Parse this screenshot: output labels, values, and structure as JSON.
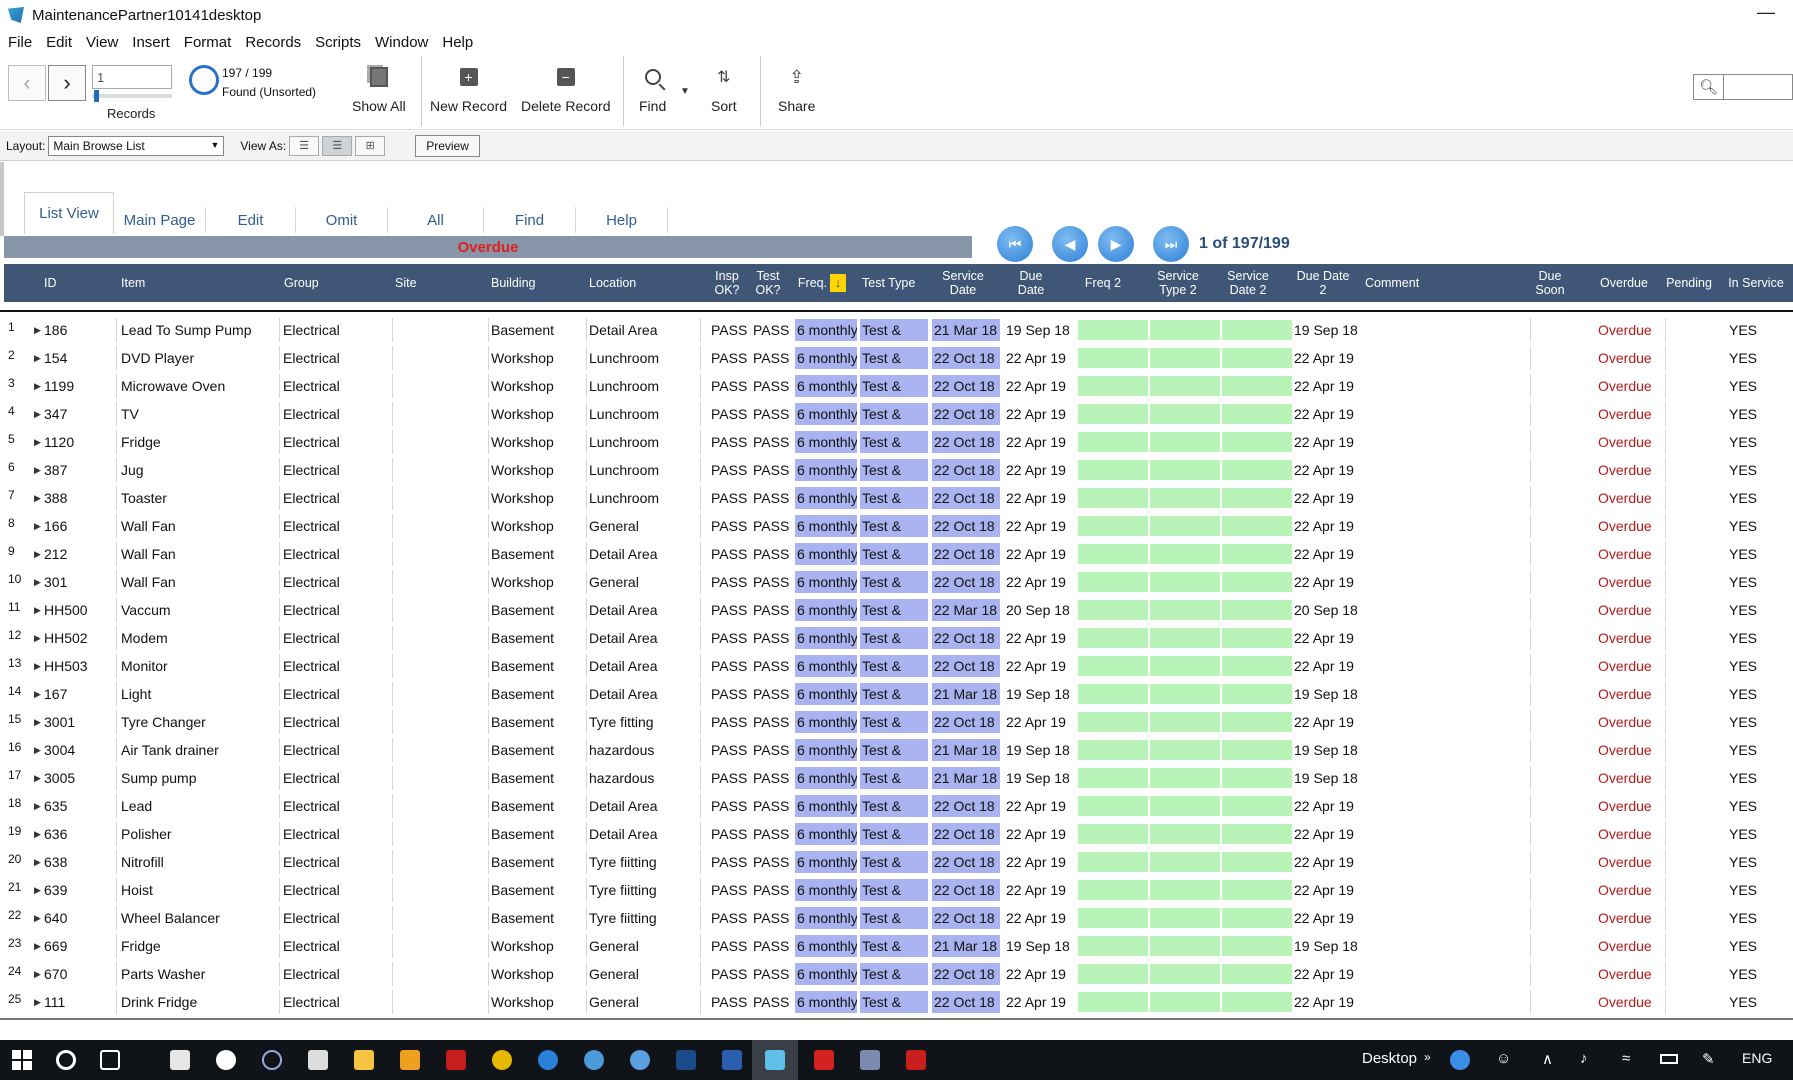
{
  "window": {
    "title": "MaintenancePartner10141desktop",
    "minimize_glyph": "—"
  },
  "menu": [
    "File",
    "Edit",
    "View",
    "Insert",
    "Format",
    "Records",
    "Scripts",
    "Window",
    "Help"
  ],
  "toolbar": {
    "record_input_value": "1",
    "records_label": "Records",
    "found_count": "197 / 199",
    "found_state": "Found (Unsorted)",
    "show_all": "Show All",
    "new_record": "New Record",
    "delete_record": "Delete Record",
    "find": "Find",
    "sort": "Sort",
    "share": "Share"
  },
  "layoutbar": {
    "layout_label": "Layout:",
    "layout_value": "Main Browse List",
    "view_as_label": "View As:",
    "preview": "Preview"
  },
  "tabs": [
    "List View",
    "Main Page",
    "Edit",
    "Omit",
    "All",
    "Find",
    "Help"
  ],
  "status": {
    "overdue_banner": "Overdue",
    "record_position": "1 of 197/199"
  },
  "columns": {
    "id": "ID",
    "item": "Item",
    "group": "Group",
    "site": "Site",
    "building": "Building",
    "location": "Location",
    "insp_ok": "Insp OK?",
    "test_ok": "Test OK?",
    "freq": "Freq.",
    "test_type": "Test Type",
    "service_date": "Service Date",
    "due_date": "Due Date",
    "freq2": "Freq 2",
    "service_type2": "Service Type 2",
    "service_date2": "Service Date 2",
    "due_date2": "Due Date  2",
    "comment": "Comment",
    "due_soon": "Due Soon",
    "overdue": "Overdue",
    "pending": "Pending",
    "in_service": "In Service"
  },
  "rows": [
    {
      "n": "1",
      "id": "186",
      "item": "Lead To Sump Pump",
      "group": "Electrical",
      "building": "Basement",
      "location": "Detail Area",
      "insp": "PASS",
      "test": "PASS",
      "freq": "6 monthly",
      "type": "Test &",
      "sdate": "21 Mar 18",
      "due": "19 Sep 18",
      "due2": "19 Sep 18",
      "overdue": "Overdue",
      "insvc": "YES"
    },
    {
      "n": "2",
      "id": "154",
      "item": "DVD Player",
      "group": "Electrical",
      "building": "Workshop",
      "location": "Lunchroom",
      "insp": "PASS",
      "test": "PASS",
      "freq": "6 monthly",
      "type": "Test &",
      "sdate": "22 Oct 18",
      "due": "22 Apr 19",
      "due2": "22 Apr 19",
      "overdue": "Overdue",
      "insvc": "YES"
    },
    {
      "n": "3",
      "id": "1199",
      "item": "Microwave Oven",
      "group": "Electrical",
      "building": "Workshop",
      "location": "Lunchroom",
      "insp": "PASS",
      "test": "PASS",
      "freq": "6 monthly",
      "type": "Test &",
      "sdate": "22 Oct 18",
      "due": "22 Apr 19",
      "due2": "22 Apr 19",
      "overdue": "Overdue",
      "insvc": "YES"
    },
    {
      "n": "4",
      "id": "347",
      "item": "TV",
      "group": "Electrical",
      "building": "Workshop",
      "location": "Lunchroom",
      "insp": "PASS",
      "test": "PASS",
      "freq": "6 monthly",
      "type": "Test &",
      "sdate": "22 Oct 18",
      "due": "22 Apr 19",
      "due2": "22 Apr 19",
      "overdue": "Overdue",
      "insvc": "YES"
    },
    {
      "n": "5",
      "id": "1120",
      "item": "Fridge",
      "group": "Electrical",
      "building": "Workshop",
      "location": "Lunchroom",
      "insp": "PASS",
      "test": "PASS",
      "freq": "6 monthly",
      "type": "Test &",
      "sdate": "22 Oct 18",
      "due": "22 Apr 19",
      "due2": "22 Apr 19",
      "overdue": "Overdue",
      "insvc": "YES"
    },
    {
      "n": "6",
      "id": "387",
      "item": "Jug",
      "group": "Electrical",
      "building": "Workshop",
      "location": "Lunchroom",
      "insp": "PASS",
      "test": "PASS",
      "freq": "6 monthly",
      "type": "Test &",
      "sdate": "22 Oct 18",
      "due": "22 Apr 19",
      "due2": "22 Apr 19",
      "overdue": "Overdue",
      "insvc": "YES"
    },
    {
      "n": "7",
      "id": "388",
      "item": "Toaster",
      "group": "Electrical",
      "building": "Workshop",
      "location": "Lunchroom",
      "insp": "PASS",
      "test": "PASS",
      "freq": "6 monthly",
      "type": "Test &",
      "sdate": "22 Oct 18",
      "due": "22 Apr 19",
      "due2": "22 Apr 19",
      "overdue": "Overdue",
      "insvc": "YES"
    },
    {
      "n": "8",
      "id": "166",
      "item": "Wall Fan",
      "group": "Electrical",
      "building": "Workshop",
      "location": "General",
      "insp": "PASS",
      "test": "PASS",
      "freq": "6 monthly",
      "type": "Test &",
      "sdate": "22 Oct 18",
      "due": "22 Apr 19",
      "due2": "22 Apr 19",
      "overdue": "Overdue",
      "insvc": "YES"
    },
    {
      "n": "9",
      "id": "212",
      "item": "Wall Fan",
      "group": "Electrical",
      "building": "Basement",
      "location": "Detail Area",
      "insp": "PASS",
      "test": "PASS",
      "freq": "6 monthly",
      "type": "Test &",
      "sdate": "22 Oct 18",
      "due": "22 Apr 19",
      "due2": "22 Apr 19",
      "overdue": "Overdue",
      "insvc": "YES"
    },
    {
      "n": "10",
      "id": "301",
      "item": "Wall Fan",
      "group": "Electrical",
      "building": "Workshop",
      "location": "General",
      "insp": "PASS",
      "test": "PASS",
      "freq": "6 monthly",
      "type": "Test &",
      "sdate": "22 Oct 18",
      "due": "22 Apr 19",
      "due2": "22 Apr 19",
      "overdue": "Overdue",
      "insvc": "YES"
    },
    {
      "n": "11",
      "id": "HH500",
      "item": "Vaccum",
      "group": "Electrical",
      "building": "Basement",
      "location": "Detail Area",
      "insp": "PASS",
      "test": "PASS",
      "freq": "6 monthly",
      "type": "Test &",
      "sdate": "22 Mar 18",
      "due": "20 Sep 18",
      "due2": "20 Sep 18",
      "overdue": "Overdue",
      "insvc": "YES"
    },
    {
      "n": "12",
      "id": "HH502",
      "item": "Modem",
      "group": "Electrical",
      "building": "Basement",
      "location": "Detail Area",
      "insp": "PASS",
      "test": "PASS",
      "freq": "6 monthly",
      "type": "Test &",
      "sdate": "22 Oct 18",
      "due": "22 Apr 19",
      "due2": "22 Apr 19",
      "overdue": "Overdue",
      "insvc": "YES"
    },
    {
      "n": "13",
      "id": "HH503",
      "item": "Monitor",
      "group": "Electrical",
      "building": "Basement",
      "location": "Detail Area",
      "insp": "PASS",
      "test": "PASS",
      "freq": "6 monthly",
      "type": "Test &",
      "sdate": "22 Oct 18",
      "due": "22 Apr 19",
      "due2": "22 Apr 19",
      "overdue": "Overdue",
      "insvc": "YES"
    },
    {
      "n": "14",
      "id": "167",
      "item": "Light",
      "group": "Electrical",
      "building": "Basement",
      "location": "Detail Area",
      "insp": "PASS",
      "test": "PASS",
      "freq": "6 monthly",
      "type": "Test &",
      "sdate": "21 Mar 18",
      "due": "19 Sep 18",
      "due2": "19 Sep 18",
      "overdue": "Overdue",
      "insvc": "YES"
    },
    {
      "n": "15",
      "id": "3001",
      "item": "Tyre Changer",
      "group": "Electrical",
      "building": "Basement",
      "location": "Tyre fitting",
      "insp": "PASS",
      "test": "PASS",
      "freq": "6 monthly",
      "type": "Test &",
      "sdate": "22 Oct 18",
      "due": "22 Apr 19",
      "due2": "22 Apr 19",
      "overdue": "Overdue",
      "insvc": "YES"
    },
    {
      "n": "16",
      "id": "3004",
      "item": "Air Tank drainer",
      "group": "Electrical",
      "building": "Basement",
      "location": "hazardous",
      "insp": "PASS",
      "test": "PASS",
      "freq": "6 monthly",
      "type": "Test &",
      "sdate": "21 Mar 18",
      "due": "19 Sep 18",
      "due2": "19 Sep 18",
      "overdue": "Overdue",
      "insvc": "YES"
    },
    {
      "n": "17",
      "id": "3005",
      "item": "Sump pump",
      "group": "Electrical",
      "building": "Basement",
      "location": "hazardous",
      "insp": "PASS",
      "test": "PASS",
      "freq": "6 monthly",
      "type": "Test &",
      "sdate": "21 Mar 18",
      "due": "19 Sep 18",
      "due2": "19 Sep 18",
      "overdue": "Overdue",
      "insvc": "YES"
    },
    {
      "n": "18",
      "id": "635",
      "item": "Lead",
      "group": "Electrical",
      "building": "Basement",
      "location": "Detail Area",
      "insp": "PASS",
      "test": "PASS",
      "freq": "6 monthly",
      "type": "Test &",
      "sdate": "22 Oct 18",
      "due": "22 Apr 19",
      "due2": "22 Apr 19",
      "overdue": "Overdue",
      "insvc": "YES"
    },
    {
      "n": "19",
      "id": "636",
      "item": "Polisher",
      "group": "Electrical",
      "building": "Basement",
      "location": "Detail Area",
      "insp": "PASS",
      "test": "PASS",
      "freq": "6 monthly",
      "type": "Test &",
      "sdate": "22 Oct 18",
      "due": "22 Apr 19",
      "due2": "22 Apr 19",
      "overdue": "Overdue",
      "insvc": "YES"
    },
    {
      "n": "20",
      "id": "638",
      "item": "Nitrofill",
      "group": "Electrical",
      "building": "Basement",
      "location": "Tyre fiitting",
      "insp": "PASS",
      "test": "PASS",
      "freq": "6 monthly",
      "type": "Test &",
      "sdate": "22 Oct 18",
      "due": "22 Apr 19",
      "due2": "22 Apr 19",
      "overdue": "Overdue",
      "insvc": "YES"
    },
    {
      "n": "21",
      "id": "639",
      "item": "Hoist",
      "group": "Electrical",
      "building": "Basement",
      "location": "Tyre fiitting",
      "insp": "PASS",
      "test": "PASS",
      "freq": "6 monthly",
      "type": "Test &",
      "sdate": "22 Oct 18",
      "due": "22 Apr 19",
      "due2": "22 Apr 19",
      "overdue": "Overdue",
      "insvc": "YES"
    },
    {
      "n": "22",
      "id": "640",
      "item": "Wheel Balancer",
      "group": "Electrical",
      "building": "Basement",
      "location": "Tyre fiitting",
      "insp": "PASS",
      "test": "PASS",
      "freq": "6 monthly",
      "type": "Test &",
      "sdate": "22 Oct 18",
      "due": "22 Apr 19",
      "due2": "22 Apr 19",
      "overdue": "Overdue",
      "insvc": "YES"
    },
    {
      "n": "23",
      "id": "669",
      "item": "Fridge",
      "group": "Electrical",
      "building": "Workshop",
      "location": "General",
      "insp": "PASS",
      "test": "PASS",
      "freq": "6 monthly",
      "type": "Test &",
      "sdate": "21 Mar 18",
      "due": "19 Sep 18",
      "due2": "19 Sep 18",
      "overdue": "Overdue",
      "insvc": "YES"
    },
    {
      "n": "24",
      "id": "670",
      "item": "Parts Washer",
      "group": "Electrical",
      "building": "Workshop",
      "location": "General",
      "insp": "PASS",
      "test": "PASS",
      "freq": "6 monthly",
      "type": "Test &",
      "sdate": "22 Oct 18",
      "due": "22 Apr 19",
      "due2": "22 Apr 19",
      "overdue": "Overdue",
      "insvc": "YES"
    },
    {
      "n": "25",
      "id": "111",
      "item": "Drink Fridge",
      "group": "Electrical",
      "building": "Workshop",
      "location": "General",
      "insp": "PASS",
      "test": "PASS",
      "freq": "6 monthly",
      "type": "Test &",
      "sdate": "22 Oct 18",
      "due": "22 Apr 19",
      "due2": "22 Apr 19",
      "overdue": "Overdue",
      "insvc": "YES"
    }
  ],
  "taskbar": {
    "desktop_label": "Desktop",
    "language": "ENG"
  },
  "colors": {
    "header_bg": "#3f5677",
    "overdue_text": "#b41a1a",
    "highlight_blue": "#a9b3f0",
    "highlight_green": "#b8f3b8",
    "sort_indicator": "#ffd400"
  }
}
